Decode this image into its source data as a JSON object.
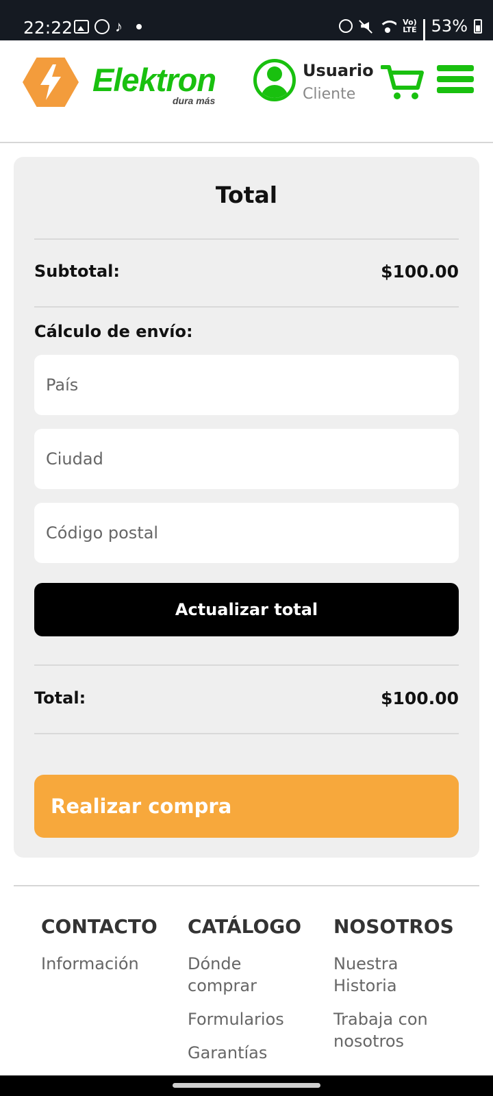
{
  "status_bar": {
    "time": "22:22",
    "battery": "53%",
    "lte_top": "Vo)",
    "lte_bottom": "LTE",
    "icons": [
      "gallery-icon",
      "whatsapp-icon",
      "tiktok-icon",
      "alarm-icon",
      "mute-icon",
      "wifi-icon",
      "signal-icon",
      "battery-icon"
    ]
  },
  "header": {
    "brand": "Elektron",
    "tagline": "dura más",
    "user_name": "Usuario",
    "user_role": "Cliente",
    "accent_color": "#19c00f",
    "logo_color": "#f39c3c"
  },
  "totals": {
    "title": "Total",
    "subtotal_label": "Subtotal:",
    "subtotal_value": "$100.00",
    "shipping_label": "Cálculo de envío:",
    "country_placeholder": "País",
    "city_placeholder": "Ciudad",
    "postal_placeholder": "Código postal",
    "update_button": "Actualizar total",
    "total_label": "Total:",
    "total_value": "$100.00",
    "buy_button": "Realizar compra",
    "buy_color": "#f7a83c"
  },
  "footer": {
    "columns": [
      {
        "title": "CONTACTO",
        "links": [
          "Información"
        ]
      },
      {
        "title": "CATÁLOGO",
        "links": [
          "Dónde comprar",
          "Formularios",
          "Garantías"
        ]
      },
      {
        "title": "NOSOTROS",
        "links": [
          "Nuestra Historia",
          "Trabaja con nosotros"
        ]
      }
    ]
  }
}
